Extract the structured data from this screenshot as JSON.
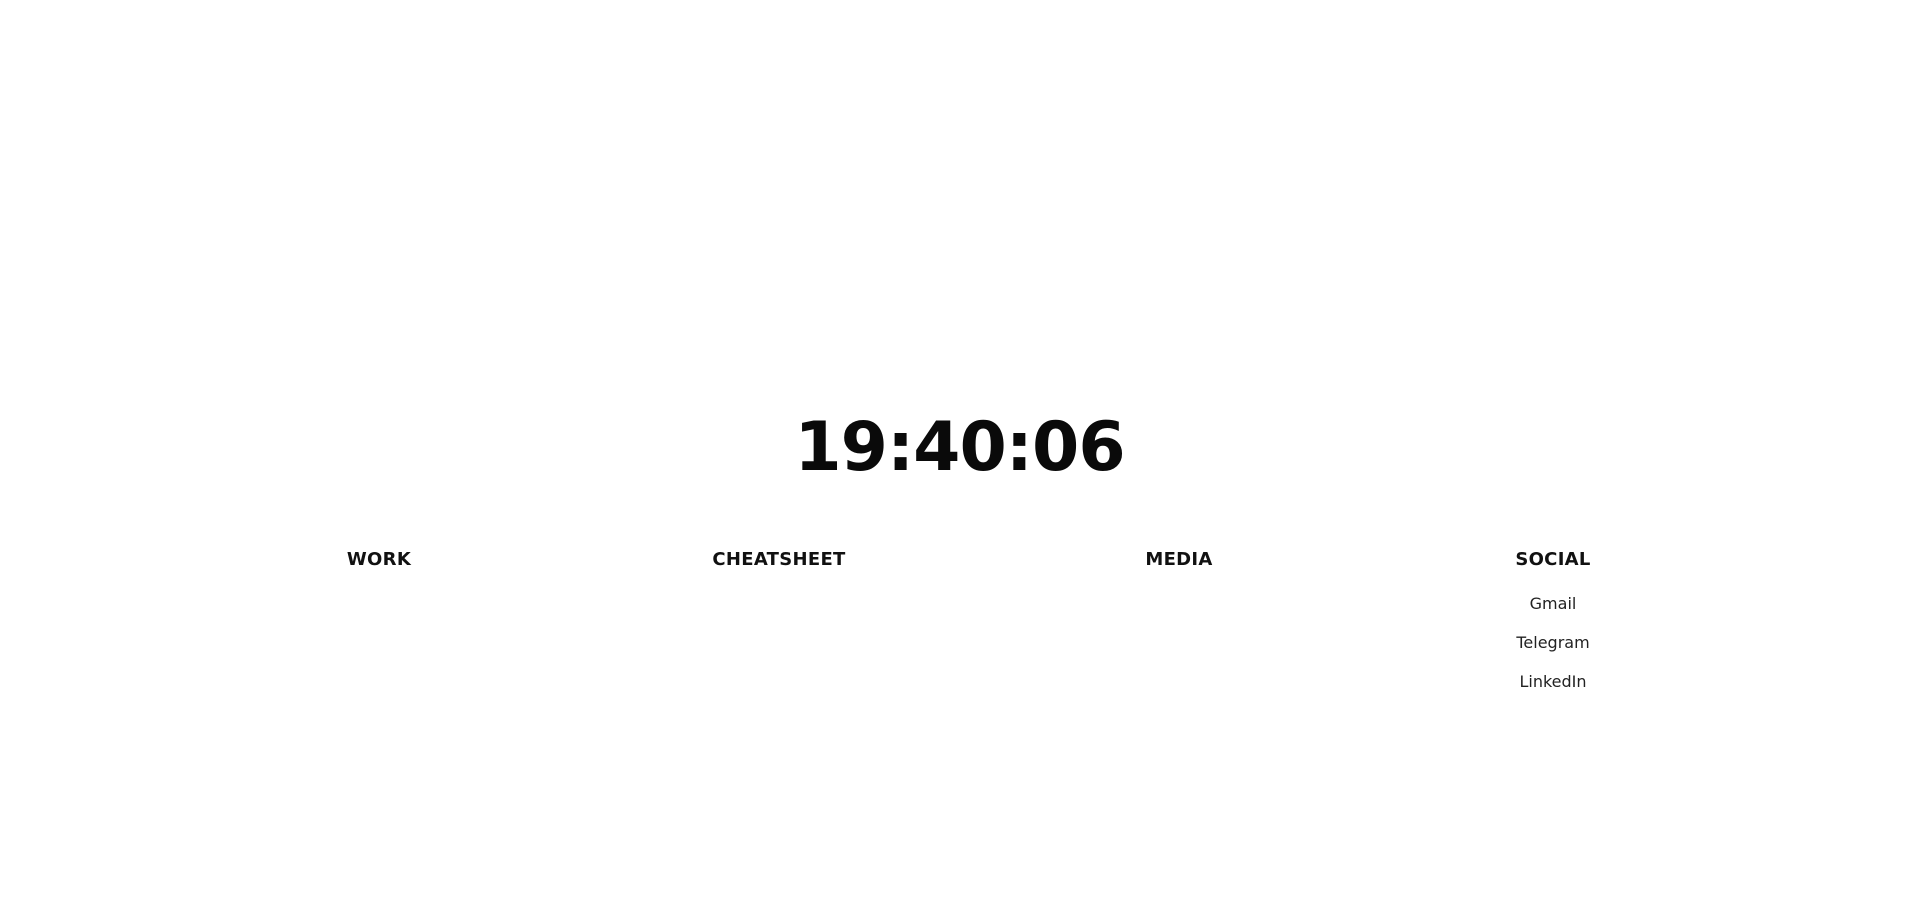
{
  "clock": {
    "time": "19:40:06"
  },
  "columns": {
    "work": {
      "title": "WORK"
    },
    "cheatsheet": {
      "title": "CHEATSHEET"
    },
    "media": {
      "title": "MEDIA"
    },
    "social": {
      "title": "SOCIAL",
      "links": [
        "Gmail",
        "Telegram",
        "LinkedIn"
      ]
    }
  }
}
